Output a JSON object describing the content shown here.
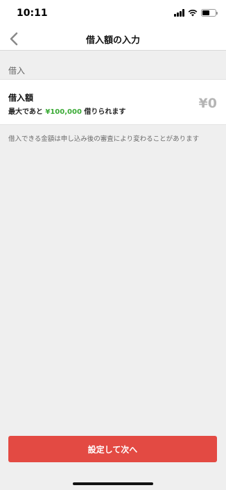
{
  "status_bar": {
    "time": "10:11"
  },
  "nav": {
    "title": "借入額の入力",
    "back_icon": "chevron-left-icon"
  },
  "section": {
    "label": "借入"
  },
  "amount_row": {
    "title": "借入額",
    "sub_prefix": "最大であと",
    "max_amount": "¥100,000",
    "sub_suffix": "借りられます",
    "value": "¥0"
  },
  "note": "借入できる金額は申し込み後の審査により変わることがあります",
  "submit": {
    "label": "設定して次へ"
  },
  "colors": {
    "accent_red": "#e34a43",
    "highlight_green": "#3aaa35",
    "placeholder_gray": "#b5b5b5",
    "background": "#efefef"
  }
}
